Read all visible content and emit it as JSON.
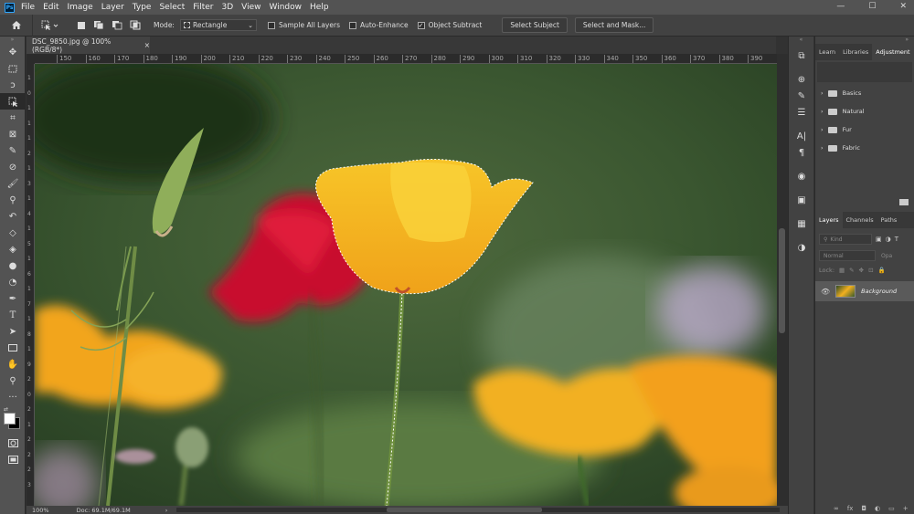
{
  "app": {
    "logo": "Ps"
  },
  "menu": [
    "File",
    "Edit",
    "Image",
    "Layer",
    "Type",
    "Select",
    "Filter",
    "3D",
    "View",
    "Window",
    "Help"
  ],
  "window_controls": [
    "—",
    "☐",
    "✕"
  ],
  "options": {
    "mode_label": "Mode:",
    "mode_value": "Rectangle",
    "sample_all_layers": "Sample All Layers",
    "auto_enhance": "Auto-Enhance",
    "object_subtract": "Object Subtract",
    "select_subject": "Select Subject",
    "select_and_mask": "Select and Mask..."
  },
  "document": {
    "tab_title": "DSC_9850.jpg @ 100% (RGB/8*)",
    "close": "×"
  },
  "ruler": {
    "h_ticks": [
      "150",
      "160",
      "170",
      "180",
      "190",
      "200",
      "210",
      "220",
      "230",
      "240",
      "250",
      "260",
      "270",
      "280",
      "290",
      "300",
      "310",
      "320",
      "330",
      "340",
      "350",
      "360",
      "370",
      "380",
      "390"
    ],
    "v_ticks": [
      "1",
      "0",
      "1",
      "1",
      "1",
      "2",
      "1",
      "3",
      "1",
      "4",
      "1",
      "5",
      "1",
      "6",
      "1",
      "7",
      "1",
      "8",
      "1",
      "9",
      "2",
      "0",
      "2",
      "1",
      "2",
      "2",
      "2",
      "3"
    ]
  },
  "status": {
    "zoom": "100%",
    "doc": "Doc: 69.1M/69.1M",
    "arrow": "›"
  },
  "panels_top": {
    "tabs": [
      "Learn",
      "Libraries",
      "Adjustment"
    ],
    "folders": [
      "Basics",
      "Natural",
      "Fur",
      "Fabric"
    ]
  },
  "layers_panel": {
    "tabs": [
      "Layers",
      "Channels",
      "Paths"
    ],
    "kind": "Kind",
    "blend": "Normal",
    "opacity": "Opa",
    "lock_label": "Lock:",
    "layer_name": "Background"
  },
  "bottom_icons": [
    "∞",
    "fx",
    "◘",
    "◐",
    "▭",
    "+",
    "🗑"
  ]
}
